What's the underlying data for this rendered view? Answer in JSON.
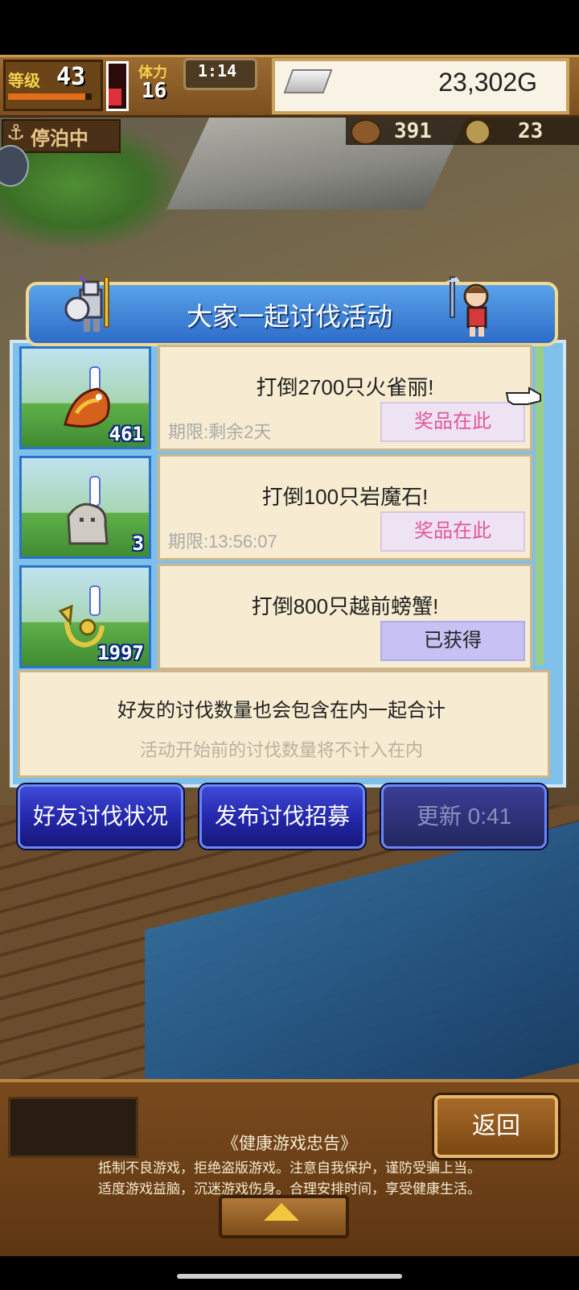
{
  "hud": {
    "level_label": "等级",
    "level_value": "43",
    "stamina_label": "体力",
    "stamina_value": "16",
    "timer": "1:14",
    "money": "23,302G",
    "status_badge": "停泊中",
    "resource1": "391",
    "resource2": "23"
  },
  "event": {
    "title": "大家一起讨伐活动",
    "quests": [
      {
        "title": "打倒2700只火雀丽!",
        "deadline": "期限:剩余2天",
        "button": "奖品在此",
        "count": "461",
        "monster": "fire-bird-icon"
      },
      {
        "title": "打倒100只岩魔石!",
        "deadline": "期限:13:56:07",
        "button": "奖品在此",
        "count": "3",
        "monster": "rock-golem-icon"
      },
      {
        "title": "打倒800只越前螃蟹!",
        "deadline": "",
        "button": "已获得",
        "count": "1997",
        "monster": "crab-icon"
      }
    ],
    "info_line1": "好友的讨伐数量也会包含在内一起合计",
    "info_line2": "活动开始前的讨伐数量将不计入在内",
    "buttons": {
      "friends": "好友讨伐状况",
      "recruit": "发布讨伐招募",
      "refresh": "更新 0:41"
    }
  },
  "footer": {
    "back": "返回",
    "notice_title": "《健康游戏忠告》",
    "notice_line1": "抵制不良游戏，拒绝盗版游戏。注意自我保护，谨防受骗上当。",
    "notice_line2": "适度游戏益脑，沉迷游戏伤身。合理安排时间，享受健康生活。"
  },
  "colors": {
    "header_blue": "#2d6cc8",
    "prize_pink": "#e2569a",
    "obtained_purple": "#c6c2f4"
  }
}
